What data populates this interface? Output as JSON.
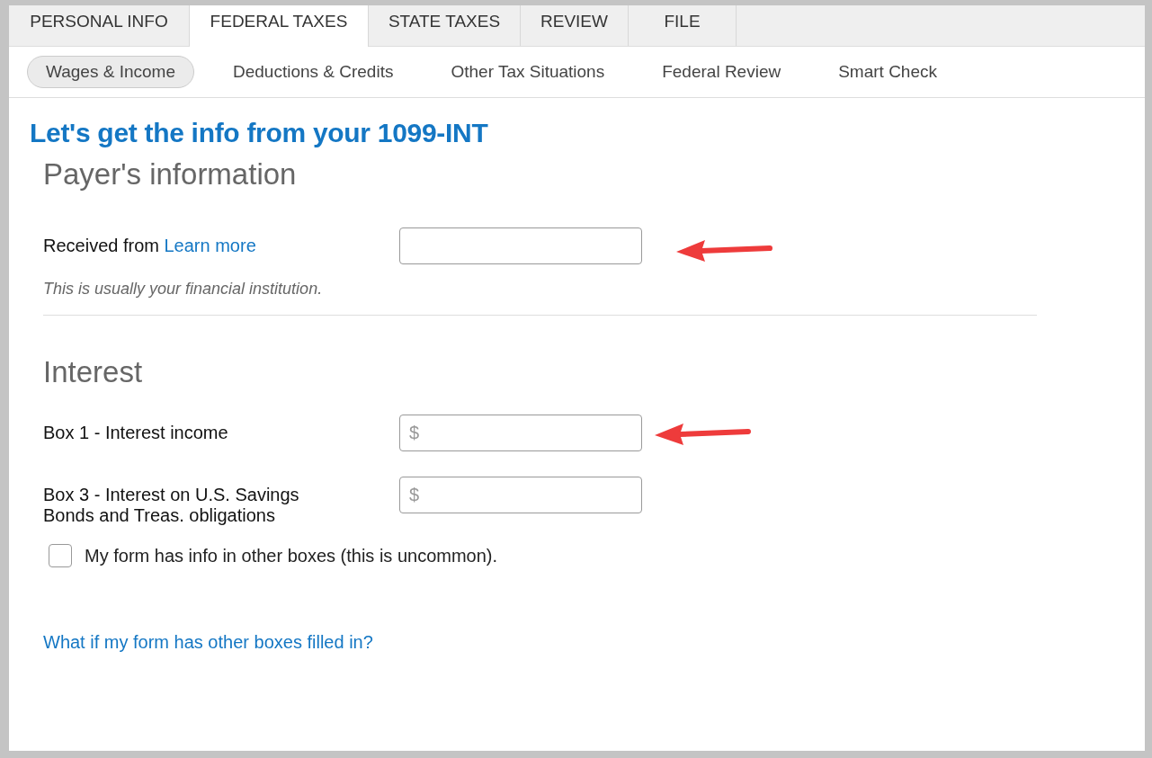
{
  "main_tabs": [
    {
      "label": "PERSONAL INFO",
      "selected": false
    },
    {
      "label": "FEDERAL TAXES",
      "selected": true
    },
    {
      "label": "STATE TAXES",
      "selected": false
    },
    {
      "label": "REVIEW",
      "selected": false
    },
    {
      "label": "FILE",
      "selected": false
    }
  ],
  "sub_tabs": [
    {
      "label": "Wages & Income",
      "selected": true
    },
    {
      "label": "Deductions & Credits",
      "selected": false
    },
    {
      "label": "Other Tax Situations",
      "selected": false
    },
    {
      "label": "Federal Review",
      "selected": false
    },
    {
      "label": "Smart Check",
      "selected": false
    }
  ],
  "page_title": "Let's get the info from your 1099-INT",
  "payer_section": {
    "heading": "Payer's information",
    "label": "Received from",
    "link": "Learn more",
    "hint": "This is usually your financial institution."
  },
  "interest_section": {
    "heading": "Interest",
    "fields": [
      {
        "label": "Box 1 - Interest income",
        "placeholder": "$"
      },
      {
        "label": "Box 3 - Interest on U.S. Savings Bonds and Treas. obligations",
        "placeholder": "$"
      }
    ],
    "checkbox": {
      "label": "My form has info in other boxes (this is uncommon).",
      "checked": false
    }
  },
  "help_link": "What if my form has other boxes filled in?"
}
